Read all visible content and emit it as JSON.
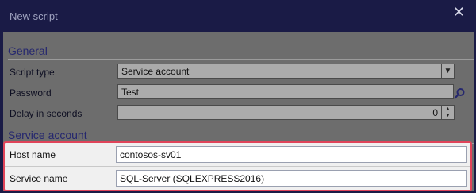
{
  "window": {
    "title": "New script",
    "close_symbol": "✕"
  },
  "general": {
    "heading": "General",
    "script_type_label": "Script type",
    "script_type_value": "Service account",
    "password_label": "Password",
    "password_value": "Test",
    "delay_label": "Delay in seconds",
    "delay_value": "0"
  },
  "service_account": {
    "heading": "Service account",
    "host_name_label": "Host name",
    "host_name_value": "contosos-sv01",
    "service_name_label": "Service name",
    "service_name_value": "SQL-Server (SQLEXPRESS2016)"
  },
  "colors": {
    "titlebar": "#1a1b46",
    "highlight_border": "#e0445a",
    "section_text": "#25276e"
  },
  "icons": {
    "close": "close-icon",
    "dropdown": "chevron-down-icon",
    "search": "search-icon",
    "spin": "spin-arrows-icon"
  }
}
